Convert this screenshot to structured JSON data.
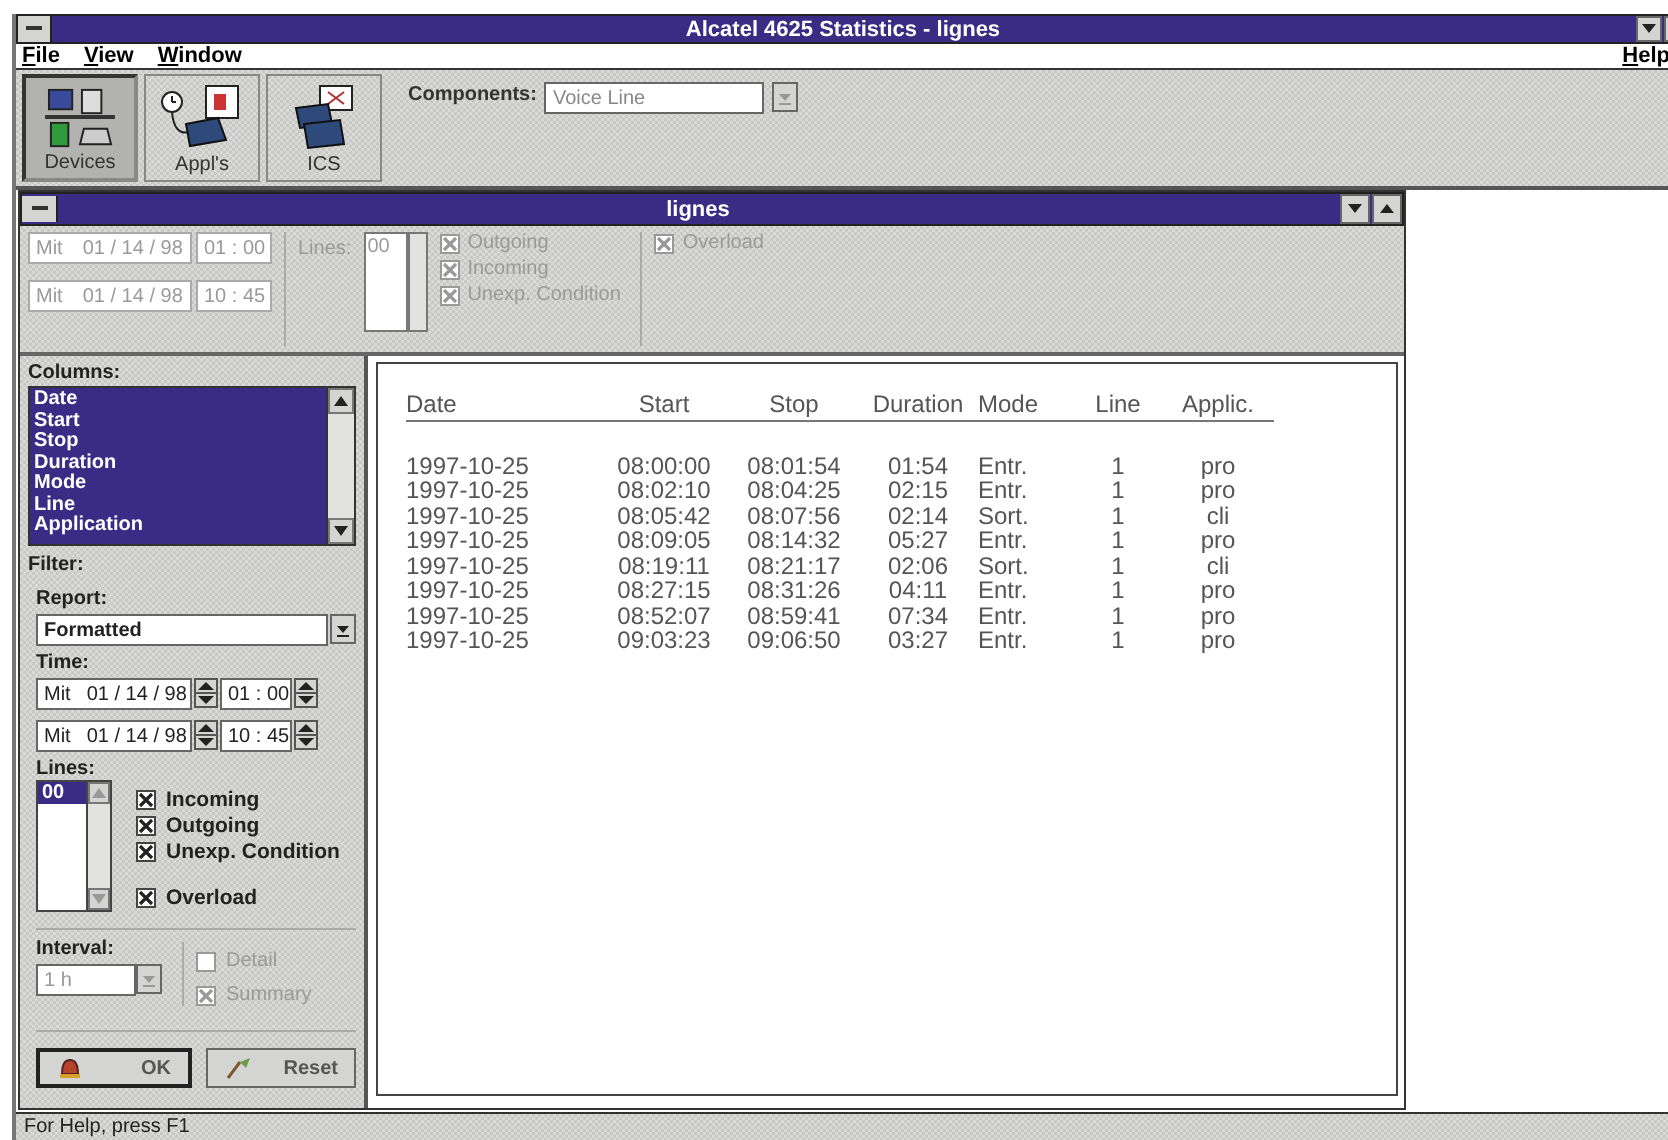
{
  "window": {
    "title": "Alcatel 4625 Statistics - lignes"
  },
  "menu": {
    "items": [
      "File",
      "View",
      "Window"
    ],
    "help": "Help"
  },
  "toolbar": {
    "buttons": [
      {
        "label": "Devices",
        "selected": true
      },
      {
        "label": "Appl's",
        "selected": false
      },
      {
        "label": "ICS",
        "selected": false
      }
    ],
    "components_label": "Components:",
    "components_value": "Voice Line"
  },
  "child_window": {
    "title": "lignes"
  },
  "summary": {
    "disabled": true,
    "periods": [
      {
        "day": "Mit",
        "date": "01 / 14 / 98",
        "time": "01 : 00"
      },
      {
        "day": "Mit",
        "date": "01 / 14 / 98",
        "time": "10 : 45"
      }
    ],
    "lines_label": "Lines:",
    "lines": [
      "00"
    ],
    "flags": [
      {
        "label": "Outgoing",
        "checked": true
      },
      {
        "label": "Incoming",
        "checked": true
      },
      {
        "label": "Unexp. Condition",
        "checked": true
      }
    ],
    "overload": {
      "label": "Overload",
      "checked": true
    }
  },
  "panel": {
    "columns_label": "Columns:",
    "columns": [
      {
        "label": "Date",
        "selected": true
      },
      {
        "label": "Start",
        "selected": true
      },
      {
        "label": "Stop",
        "selected": true
      },
      {
        "label": "Duration",
        "selected": true
      },
      {
        "label": "Mode",
        "selected": true
      },
      {
        "label": "Line",
        "selected": true
      },
      {
        "label": "Application",
        "selected": true
      }
    ],
    "filter_label": "Filter:",
    "report_label": "Report:",
    "report_value": "Formatted",
    "time_label": "Time:",
    "periods": [
      {
        "day": "Mit",
        "date": "01 / 14 / 98",
        "time": "01 : 00"
      },
      {
        "day": "Mit",
        "date": "01 / 14 / 98",
        "time": "10 : 45"
      }
    ],
    "lines_label": "Lines:",
    "lines": [
      {
        "label": "00",
        "selected": true
      }
    ],
    "flags": [
      {
        "label": "Incoming",
        "checked": true
      },
      {
        "label": "Outgoing",
        "checked": true
      },
      {
        "label": "Unexp. Condition",
        "checked": true
      },
      {
        "label": "Overload",
        "checked": true
      }
    ],
    "interval_label": "Interval:",
    "interval_value": "1 h",
    "interval_disabled": true,
    "options": [
      {
        "label": "Detail",
        "checked": false,
        "disabled": true
      },
      {
        "label": "Summary",
        "checked": true,
        "disabled": true
      }
    ],
    "buttons": [
      {
        "label": "OK",
        "kind": "ok"
      },
      {
        "label": "Reset",
        "kind": "reset"
      }
    ]
  },
  "table": {
    "columns": [
      "Date",
      "Start",
      "Stop",
      "Duration",
      "Mode",
      "Line",
      "Applic."
    ],
    "rows": [
      [
        "1997-10-25",
        "08:00:00",
        "08:01:54",
        "01:54",
        "Entr.",
        "1",
        "pro"
      ],
      [
        "1997-10-25",
        "08:02:10",
        "08:04:25",
        "02:15",
        "Entr.",
        "1",
        "pro"
      ],
      [
        "1997-10-25",
        "08:05:42",
        "08:07:56",
        "02:14",
        "Sort.",
        "1",
        "cli"
      ],
      [
        "1997-10-25",
        "08:09:05",
        "08:14:32",
        "05:27",
        "Entr.",
        "1",
        "pro"
      ],
      [
        "1997-10-25",
        "08:19:11",
        "08:21:17",
        "02:06",
        "Sort.",
        "1",
        "cli"
      ],
      [
        "1997-10-25",
        "08:27:15",
        "08:31:26",
        "04:11",
        "Entr.",
        "1",
        "pro"
      ],
      [
        "1997-10-25",
        "08:52:07",
        "08:59:41",
        "07:34",
        "Entr.",
        "1",
        "pro"
      ],
      [
        "1997-10-25",
        "09:03:23",
        "09:06:50",
        "03:27",
        "Entr.",
        "1",
        "pro"
      ]
    ]
  },
  "status_bar": {
    "text": "For Help, press F1"
  }
}
